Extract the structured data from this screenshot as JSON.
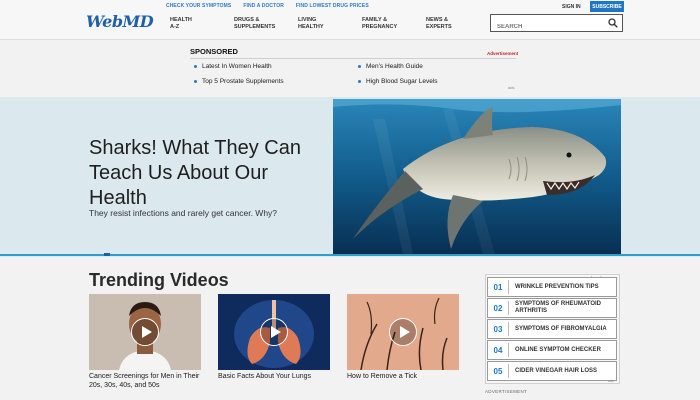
{
  "header": {
    "logo": "WebMD",
    "utility_links": [
      "CHECK YOUR SYMPTOMS",
      "FIND A DOCTOR",
      "FIND LOWEST DRUG PRICES"
    ],
    "nav": [
      {
        "line1": "HEALTH",
        "line2": "A-Z"
      },
      {
        "line1": "DRUGS &",
        "line2": "SUPPLEMENTS"
      },
      {
        "line1": "LIVING",
        "line2": "HEALTHY"
      },
      {
        "line1": "FAMILY &",
        "line2": "PREGNANCY"
      },
      {
        "line1": "NEWS &",
        "line2": "EXPERTS"
      }
    ],
    "search_placeholder": "SEARCH",
    "signin": "SIGN IN",
    "subscribe": "SUBSCRIBE"
  },
  "sponsored": {
    "title": "SPONSORED",
    "ad_label": "Advertisement",
    "links": [
      "Latest In Women Health",
      "Men's Health Guide",
      "Top 5 Prostate Supplements",
      "High Blood Sugar Levels"
    ],
    "adchoice": "ads"
  },
  "hero": {
    "title": "Sharks! What They Can Teach Us About Our Health",
    "subtitle": "They resist infections and rarely get cancer. Why?"
  },
  "trending": {
    "title": "Trending Videos",
    "videos": [
      {
        "caption": "Cancer Screenings for Men in Their 20s, 30s, 40s, and 50s"
      },
      {
        "caption": "Basic Facts About Your Lungs"
      },
      {
        "caption": "How to Remove a Tick"
      }
    ]
  },
  "sidebar": {
    "ad_label": "Advertisement",
    "items": [
      {
        "num": "01",
        "label": "WRINKLE PREVENTION TIPS"
      },
      {
        "num": "02",
        "label": "SYMPTOMS OF RHEUMATOID ARTHRITIS"
      },
      {
        "num": "03",
        "label": "SYMPTOMS OF FIBROMYALGIA"
      },
      {
        "num": "04",
        "label": "ONLINE SYMPTOM CHECKER"
      },
      {
        "num": "05",
        "label": "CIDER VINEGAR HAIR LOSS"
      }
    ],
    "adchoice": "ads",
    "footer": "ADVERTISEMENT"
  },
  "colors": {
    "brand_blue": "#1f5fa8",
    "accent_blue": "#1f76c4",
    "hero_bg": "#dbe8ee",
    "ad_red": "#c7222b"
  }
}
